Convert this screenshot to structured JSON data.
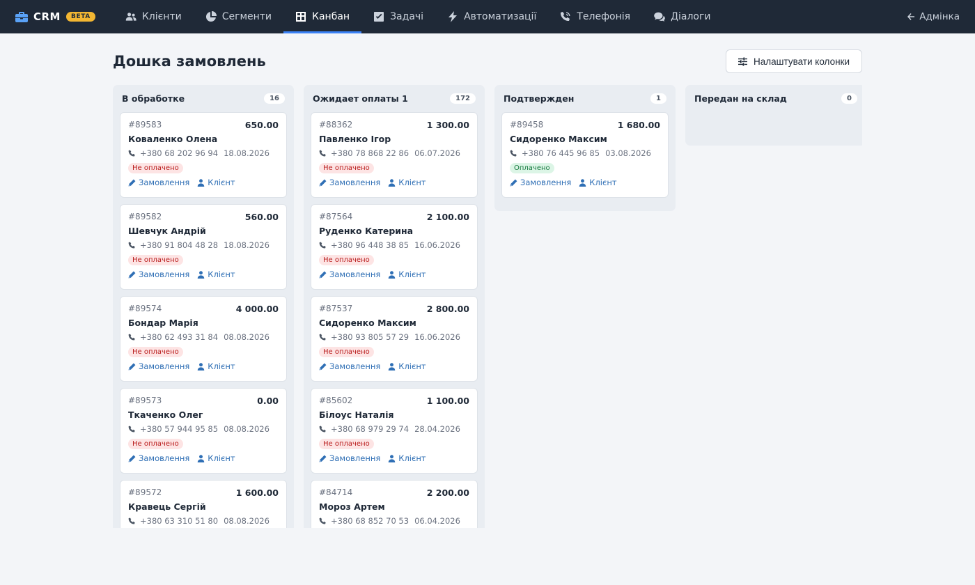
{
  "brand": {
    "name": "CRM",
    "badge": "BETA"
  },
  "nav": [
    {
      "label": "Клієнти",
      "icon": "users-icon",
      "active": false
    },
    {
      "label": "Сегменти",
      "icon": "pie-chart-icon",
      "active": false
    },
    {
      "label": "Канбан",
      "icon": "table-grid-icon",
      "active": true
    },
    {
      "label": "Задачі",
      "icon": "checkbox-icon",
      "active": false
    },
    {
      "label": "Автоматизації",
      "icon": "bolt-icon",
      "active": false
    },
    {
      "label": "Телефонія",
      "icon": "phone-volume-icon",
      "active": false
    },
    {
      "label": "Діалоги",
      "icon": "chat-bubbles-icon",
      "active": false
    }
  ],
  "admin_link": "Адмінка",
  "page": {
    "title": "Дошка замовлень",
    "settings_button": "Налаштувати колонки"
  },
  "card_labels": {
    "order_link": "Замовлення",
    "client_link": "Клієнт"
  },
  "colors": {
    "accent": "#3b82f6",
    "topbar": "#1f2937",
    "link": "#2f6fb5",
    "unpaid_bg": "#fde4e4",
    "paid_bg": "#dcf5e6"
  },
  "columns": [
    {
      "title": "В обработке",
      "count": "16",
      "cards": [
        {
          "id": "#89583",
          "amount": "650.00",
          "client": "Коваленко Олена",
          "phone": "+380 68 202 96 94",
          "date": "18.08.2026",
          "status": "Не оплачено",
          "paid": false
        },
        {
          "id": "#89582",
          "amount": "560.00",
          "client": "Шевчук Андрій",
          "phone": "+380 91 804 48 28",
          "date": "18.08.2026",
          "status": "Не оплачено",
          "paid": false
        },
        {
          "id": "#89574",
          "amount": "4 000.00",
          "client": "Бондар Марія",
          "phone": "+380 62 493 31 84",
          "date": "08.08.2026",
          "status": "Не оплачено",
          "paid": false
        },
        {
          "id": "#89573",
          "amount": "0.00",
          "client": "Ткаченко Олег",
          "phone": "+380 57 944 95 85",
          "date": "08.08.2026",
          "status": "Не оплачено",
          "paid": false
        },
        {
          "id": "#89572",
          "amount": "1 600.00",
          "client": "Кравець Сергій",
          "phone": "+380 63 310 51 80",
          "date": "08.08.2026",
          "status": "",
          "paid": false
        }
      ]
    },
    {
      "title": "Ожидает оплаты 1",
      "count": "172",
      "cards": [
        {
          "id": "#88362",
          "amount": "1 300.00",
          "client": "Павленко Ігор",
          "phone": "+380 78 868 22 86",
          "date": "06.07.2026",
          "status": "Не оплачено",
          "paid": false
        },
        {
          "id": "#87564",
          "amount": "2 100.00",
          "client": "Руденко Катерина",
          "phone": "+380 96 448 38 85",
          "date": "16.06.2026",
          "status": "Не оплачено",
          "paid": false
        },
        {
          "id": "#87537",
          "amount": "2 800.00",
          "client": "Сидоренко Максим",
          "phone": "+380 93 805 57 29",
          "date": "16.06.2026",
          "status": "Не оплачено",
          "paid": false
        },
        {
          "id": "#85602",
          "amount": "1 100.00",
          "client": "Білоус Наталія",
          "phone": "+380 68 979 29 74",
          "date": "28.04.2026",
          "status": "Не оплачено",
          "paid": false
        },
        {
          "id": "#84714",
          "amount": "2 200.00",
          "client": "Мороз Артем",
          "phone": "+380 68 852 70 53",
          "date": "06.04.2026",
          "status": "",
          "paid": false
        }
      ]
    },
    {
      "title": "Подтвержден",
      "count": "1",
      "cards": [
        {
          "id": "#89458",
          "amount": "1 680.00",
          "client": "Сидоренко Максим",
          "phone": "+380 76 445 96 85",
          "date": "03.08.2026",
          "status": "Оплачено",
          "paid": true
        }
      ]
    },
    {
      "title": "Передан на склад",
      "count": "0",
      "cards": []
    }
  ]
}
